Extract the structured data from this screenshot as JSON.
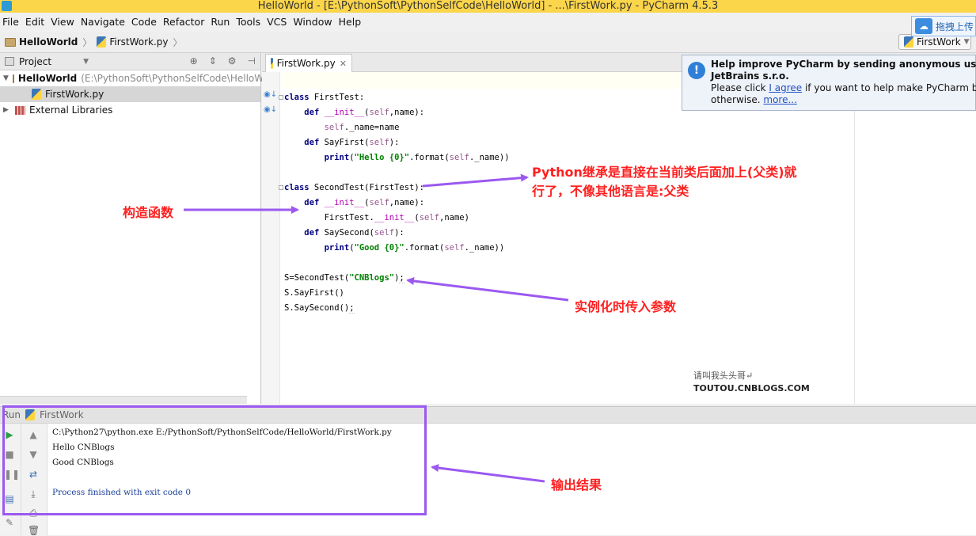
{
  "window": {
    "title": "HelloWorld - [E:\\PythonSoft\\PythonSelfCode\\HelloWorld] - ...\\FirstWork.py - PyCharm 4.5.3"
  },
  "menu": [
    "File",
    "Edit",
    "View",
    "Navigate",
    "Code",
    "Refactor",
    "Run",
    "Tools",
    "VCS",
    "Window",
    "Help"
  ],
  "breadcrumb": {
    "project": "HelloWorld",
    "file": "FirstWork.py"
  },
  "run_config": {
    "label": "FirstWork"
  },
  "baidu": {
    "label": "拖拽上传"
  },
  "project_panel": {
    "header": "Project",
    "root": {
      "name": "HelloWorld",
      "path": "(E:\\PythonSoft\\PythonSelfCode\\HelloWorld)"
    },
    "file": "FirstWork.py",
    "libraries": "External Libraries"
  },
  "editor": {
    "tab": "FirstWork.py",
    "lines": [
      "class FirstTest:",
      "    def __init__(self,name):",
      "        self._name=name",
      "    def SayFirst(self):",
      "        print(\"Hello {0}\".format(self._name))",
      "",
      "class SecondTest(FirstTest):",
      "    def __init__(self,name):",
      "        FirstTest.__init__(self,name)",
      "    def SaySecond(self):",
      "        print(\"Good {0}\".format(self._name))",
      "",
      "S=SecondTest(\"CNBlogs\");",
      "S.SayFirst()",
      "S.SaySecond();"
    ]
  },
  "notification": {
    "title": "Help improve PyCharm by sending anonymous usage s",
    "title2": "JetBrains s.r.o.",
    "line1_pre": "Please click ",
    "line1_link": "I agree",
    "line1_post": " if you want to help make PyCharm better",
    "line2_pre": "otherwise. ",
    "line2_link": "more..."
  },
  "run_panel": {
    "tab_run": "Run",
    "tab_config": "FirstWork",
    "output": [
      "C:\\Python27\\python.exe E:/PythonSoft/PythonSelfCode/HelloWorld/FirstWork.py",
      "Hello CNBlogs",
      "Good CNBlogs",
      "",
      "Process finished with exit code 0"
    ]
  },
  "annotations": {
    "inherit_line1": "Python继承是直接在当前类后面加上(父类)就",
    "inherit_line2": "行了，不像其他语言是:父类",
    "constructor": "构造函数",
    "instantiate": "实例化时传入参数",
    "output": "输出结果"
  },
  "watermark": {
    "line1": "请叫我头头哥↵",
    "line2": "TOUTOU.CNBLOGS.COM"
  },
  "colors": {
    "annotation": "#ff1f1f",
    "arrow": "#9b59f0",
    "keyword": "#000080",
    "self": "#94558d",
    "string": "#008000"
  }
}
